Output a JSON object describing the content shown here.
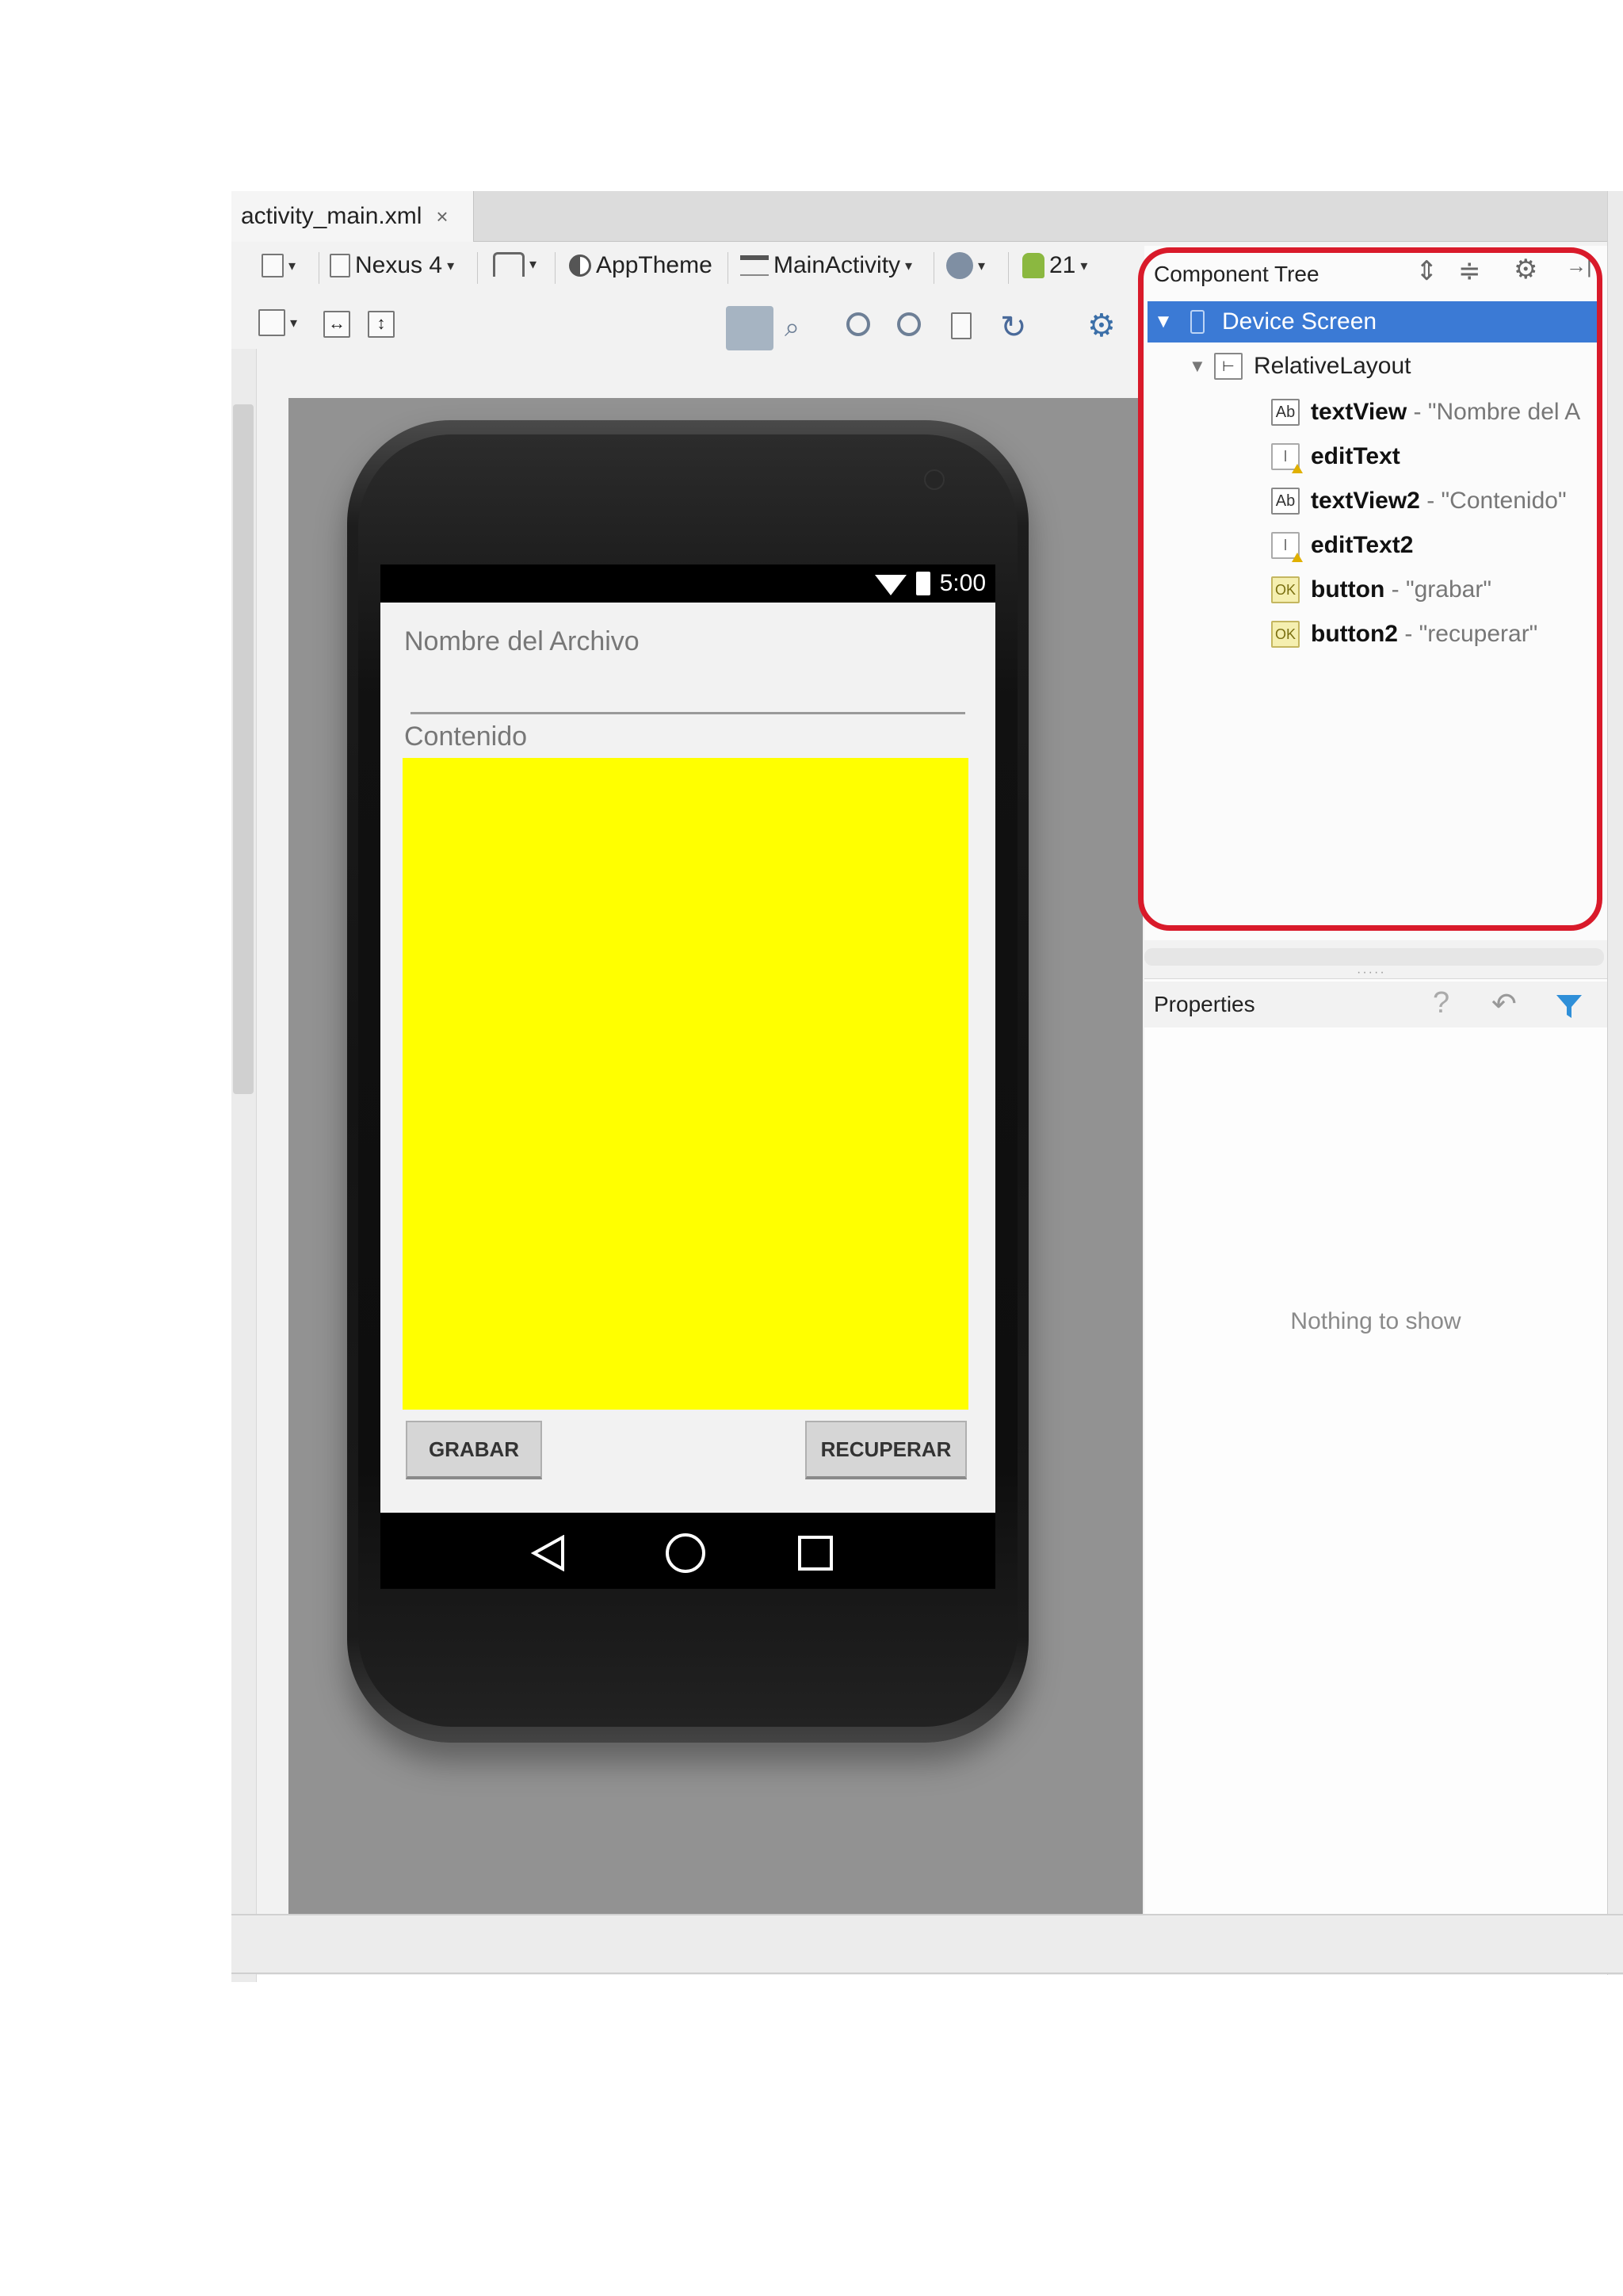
{
  "editor": {
    "tab_label": "activity_main.xml",
    "tab_close": "×"
  },
  "toolbar": {
    "device": "Nexus 4",
    "theme": "AppTheme",
    "activity": "MainActivity",
    "api_level": "21"
  },
  "phone": {
    "time": "5:00",
    "textview_label": "Nombre del Archivo",
    "textview2_label": "Contenido",
    "grabar_button": "GRABAR",
    "recuperar_button": "RECUPERAR",
    "edit_text2_color": "#ffff00"
  },
  "component_tree": {
    "title": "Component Tree",
    "root": "Device Screen",
    "layout": "RelativeLayout",
    "items": [
      {
        "icon": "Ab",
        "name": "textView",
        "text": "- \"Nombre del A"
      },
      {
        "icon": "I",
        "name": "editText",
        "text": ""
      },
      {
        "icon": "Ab",
        "name": "textView2",
        "text": "- \"Contenido\""
      },
      {
        "icon": "I",
        "name": "editText2",
        "text": ""
      },
      {
        "icon": "OK",
        "name": "button",
        "text": "- \"grabar\""
      },
      {
        "icon": "OK",
        "name": "button2",
        "text": "- \"recuperar\""
      }
    ],
    "highlight_color": "#d91a2a",
    "selection_color": "#3b7ad5"
  },
  "properties": {
    "title": "Properties",
    "empty_text": "Nothing to show"
  }
}
